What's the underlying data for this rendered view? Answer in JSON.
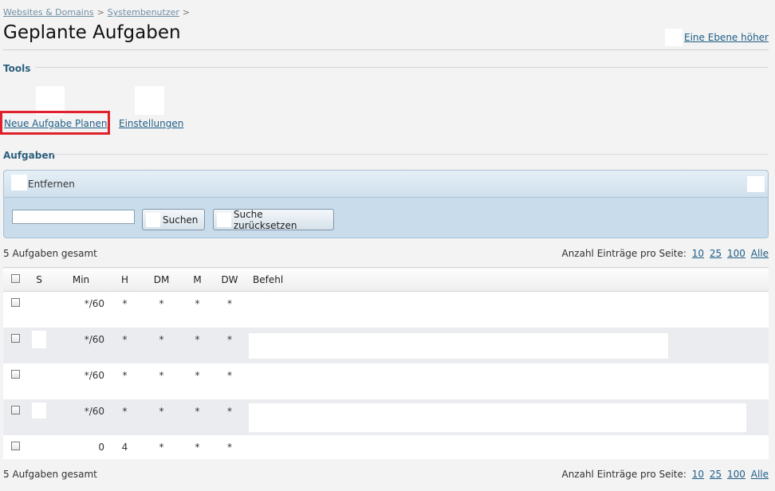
{
  "breadcrumb": {
    "items": [
      "Websites & Domains",
      "Systembenutzer"
    ],
    "separator": ">"
  },
  "page": {
    "title": "Geplante Aufgaben",
    "up_level_label": "Eine Ebene höher"
  },
  "tools": {
    "heading": "Tools",
    "items": [
      {
        "label": "Neue Aufgabe Planen",
        "icon": "schedule-task-icon"
      },
      {
        "label": "Einstellungen",
        "icon": "settings-icon"
      }
    ]
  },
  "tasks": {
    "heading": "Aufgaben",
    "toolbar": {
      "remove_label": "Entfernen",
      "search_value": "",
      "search_button": "Suchen",
      "reset_button": "Suche zurücksetzen"
    },
    "summary": "5 Aufgaben gesamt",
    "per_page_label": "Anzahl Einträge pro Seite:",
    "per_page_options": [
      "10",
      "25",
      "100",
      "Alle"
    ],
    "columns": [
      "S",
      "Min",
      "H",
      "DM",
      "M",
      "DW",
      "Befehl"
    ],
    "rows": [
      {
        "min": "*/60",
        "h": "*",
        "dm": "*",
        "m": "*",
        "dw": "*"
      },
      {
        "min": "*/60",
        "h": "*",
        "dm": "*",
        "m": "*",
        "dw": "*"
      },
      {
        "min": "*/60",
        "h": "*",
        "dm": "*",
        "m": "*",
        "dw": "*"
      },
      {
        "min": "*/60",
        "h": "*",
        "dm": "*",
        "m": "*",
        "dw": "*"
      },
      {
        "min": "0",
        "h": "4",
        "dm": "*",
        "m": "*",
        "dw": "*"
      }
    ]
  },
  "colors": {
    "link": "#1f5d86",
    "highlight": "#e0202a",
    "panel_bg": "#c9dceb"
  }
}
